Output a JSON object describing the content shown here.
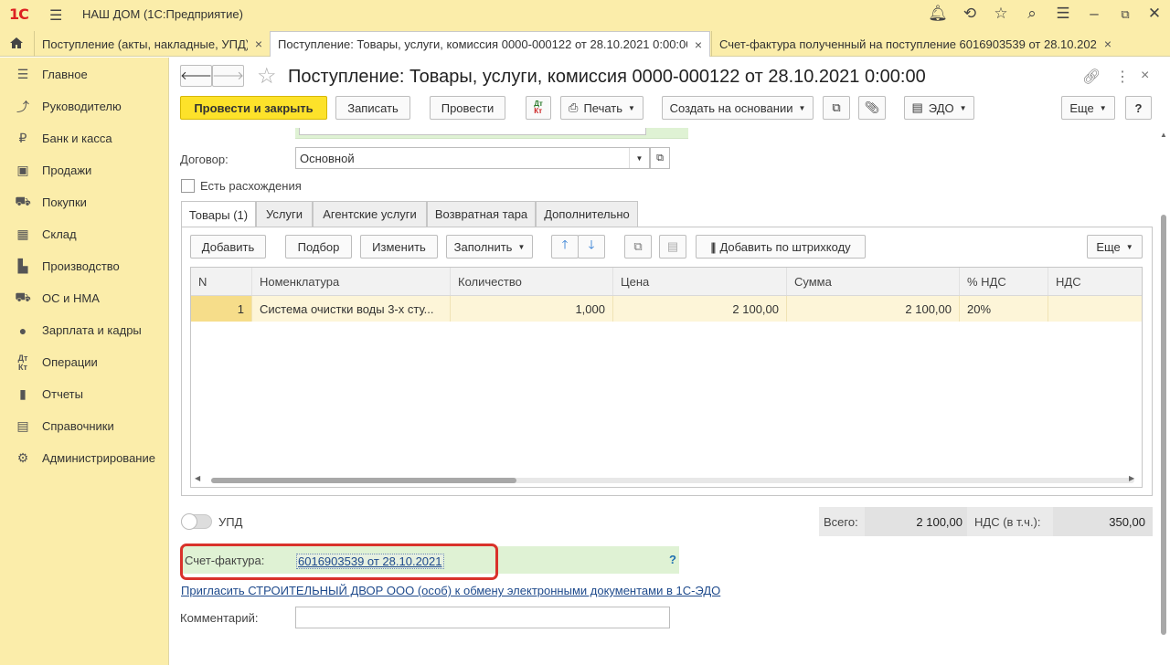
{
  "app": {
    "logo": "1С",
    "title": "НАШ ДОМ  (1С:Предприятие)"
  },
  "tabs": [
    {
      "label": "Поступление (акты, накладные, УПД)",
      "close": "×"
    },
    {
      "label": "Поступление: Товары, услуги, комиссия 0000-000122 от 28.10.2021 0:00:00",
      "close": "×"
    },
    {
      "label": "Счет-фактура полученный на поступление 6016903539 от 28.10.2021",
      "close": "×"
    }
  ],
  "sidebar": {
    "items": [
      {
        "label": "Главное",
        "icon": "list-icon"
      },
      {
        "label": "Руководителю",
        "icon": "trend-icon"
      },
      {
        "label": "Банк и касса",
        "icon": "ruble-icon"
      },
      {
        "label": "Продажи",
        "icon": "bag-icon"
      },
      {
        "label": "Покупки",
        "icon": "cart-icon"
      },
      {
        "label": "Склад",
        "icon": "warehouse-icon"
      },
      {
        "label": "Производство",
        "icon": "factory-icon"
      },
      {
        "label": "ОС и НМА",
        "icon": "truck-icon"
      },
      {
        "label": "Зарплата и кадры",
        "icon": "person-icon"
      },
      {
        "label": "Операции",
        "icon": "dt-kt-icon"
      },
      {
        "label": "Отчеты",
        "icon": "bar-chart-icon"
      },
      {
        "label": "Справочники",
        "icon": "book-icon"
      },
      {
        "label": "Администрирование",
        "icon": "gear-icon"
      }
    ]
  },
  "doc": {
    "title": "Поступление: Товары, услуги, комиссия 0000-000122 от 28.10.2021 0:00:00",
    "toolbar": {
      "post_close": "Провести и закрыть",
      "save": "Записать",
      "post": "Провести",
      "dtkt": "Дт Кт",
      "print": "Печать",
      "create_based": "Создать на основании",
      "edo": "ЭДО",
      "more": "Еще",
      "help": "?"
    },
    "contract_label": "Договор:",
    "contract_value": "Основной",
    "discrepancy_label": "Есть расхождения",
    "form_tabs": [
      "Товары (1)",
      "Услуги",
      "Агентские услуги",
      "Возвратная тара",
      "Дополнительно"
    ],
    "table_toolbar": {
      "add": "Добавить",
      "pick": "Подбор",
      "edit": "Изменить",
      "fill": "Заполнить",
      "barcode": "Добавить по штрихкоду",
      "more": "Еще"
    },
    "columns": [
      "N",
      "Номенклатура",
      "Количество",
      "Цена",
      "Сумма",
      "% НДС",
      "НДС"
    ],
    "rows": [
      {
        "n": "1",
        "item": "Система очистки воды 3-х сту...",
        "qty": "1,000",
        "price": "2 100,00",
        "sum": "2 100,00",
        "vat_rate": "20%",
        "vat": ""
      }
    ],
    "upd_label": "УПД",
    "totals": {
      "total_label": "Всего:",
      "total": "2 100,00",
      "vat_label": "НДС (в т.ч.):",
      "vat": "350,00"
    },
    "invoice_label": "Счет-фактура:",
    "invoice_link": "6016903539 от 28.10.2021",
    "invoice_help": "?",
    "invite_link": "Пригласить СТРОИТЕЛЬНЫЙ ДВОР ООО (особ) к обмену электронными документами в 1С-ЭДО",
    "comment_label": "Комментарий:",
    "comment_value": ""
  },
  "colors": {
    "yellow_panel": "#fbedaa",
    "accent_button": "#fde22a",
    "highlight_frame": "#d9322b",
    "invoice_bg": "#dff2d4"
  }
}
